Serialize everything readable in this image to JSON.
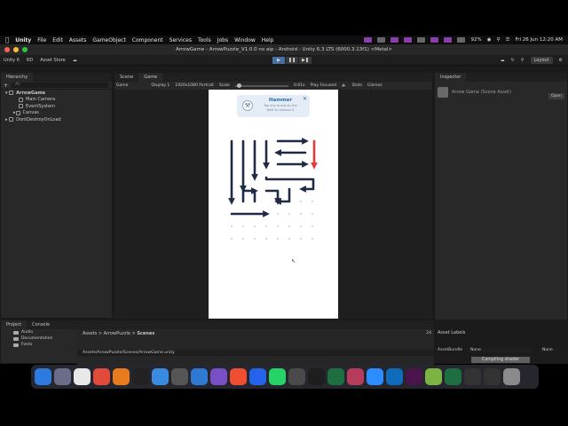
{
  "mac_menubar": {
    "apple": "",
    "items": [
      "Unity",
      "File",
      "Edit",
      "Assets",
      "GameObject",
      "Component",
      "Services",
      "Tools",
      "Jobs",
      "Window",
      "Help"
    ],
    "battery": "92%",
    "datetime": "Fri 26 Jun  12:20 AM"
  },
  "window": {
    "title": "ArrowGame - ArrowPuzzle_V1.0.0 no aip - Android - Unity 6.3 LTS (6000.3.13f1) <Metal>"
  },
  "toolbar": {
    "version": "Unity 6",
    "account": "RD",
    "asset_store": "Asset Store",
    "play": "▶",
    "pause": "❚❚",
    "step": "▶❚",
    "layout": "Layout"
  },
  "hierarchy": {
    "tab": "Hierarchy",
    "search_placeholder": "All",
    "items": [
      {
        "label": "ArrowGame",
        "indent": 0
      },
      {
        "label": "Main Camera",
        "indent": 1
      },
      {
        "label": "EventSystem",
        "indent": 1
      },
      {
        "label": "Canvas",
        "indent": 1
      },
      {
        "label": "DontDestroyOnLoad",
        "indent": 0
      }
    ]
  },
  "scene_game": {
    "tabs": [
      "Scene",
      "Game"
    ],
    "bar": {
      "mode": "Game",
      "display": "Display 1",
      "resolution": "1920x1080 Portrait",
      "scale_label": "Scale",
      "scale_value": "0.61x",
      "play_focused": "Play Focused",
      "stats": "Stats",
      "gizmos": "Gizmos"
    }
  },
  "hammer_popup": {
    "title": "Hammer",
    "desc_line1": "Tap any arrow on the",
    "desc_line2": "field to remove it",
    "close": "✕"
  },
  "inspector": {
    "tab": "Inspector",
    "title": "Arrow Game (Scene Asset)",
    "open": "Open",
    "asset_labels": "Asset Labels",
    "asset_bundle_label": "AssetBundle",
    "asset_bundle_value": "None",
    "asset_bundle_variant": "None",
    "status": "Compiling shader"
  },
  "project": {
    "tabs": [
      "Project",
      "Console"
    ],
    "tree": [
      "Audio",
      "Documentation",
      "Fonts"
    ],
    "breadcrumb": [
      "Assets",
      "ArrowPuzzle",
      "Scenes"
    ],
    "path": "Assets/ArrowPuzzle/Scenes/ArrowGame.unity",
    "count": "24"
  },
  "dock": {
    "apps": [
      "Finder",
      "Launchpad",
      "Chrome",
      "Anydesk",
      "Blender",
      "Activity",
      "Safari",
      "Unity",
      "VSCode",
      "VS",
      "Git",
      "MP3",
      "WhatsApp",
      "Monitor",
      "Terminal",
      "Excel",
      "Preview",
      "Zoom",
      "Outlook",
      "Slack",
      "Android",
      "Excel2",
      "Unity2",
      "Unity3",
      "Trash"
    ],
    "colors": [
      "#2d7ae0",
      "#6b6b8a",
      "#e8e8e8",
      "#e24a3b",
      "#e87b1e",
      "#222222",
      "#3a8be0",
      "#555555",
      "#2e7ad3",
      "#7a4fc5",
      "#f04e32",
      "#2563eb",
      "#25d366",
      "#4a4a4a",
      "#1e1e1e",
      "#1d6f42",
      "#b73b5a",
      "#2d8cff",
      "#0f6cbd",
      "#4a154b",
      "#7cb342",
      "#1d6f42",
      "#333333",
      "#333333",
      "#8a8a8a"
    ]
  },
  "colors": {
    "arrow": "#1f2b44",
    "arrow_highlight": "#e23b3b",
    "dot": "#b9bcc4",
    "popup_bg": "#e4ecf6",
    "popup_title": "#2e6db0"
  }
}
